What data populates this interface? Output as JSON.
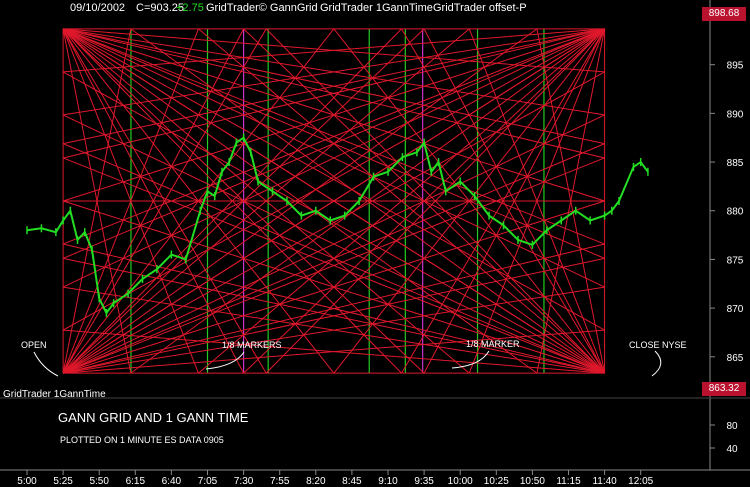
{
  "header": {
    "date": "09/10/2002",
    "close": "C=903.25",
    "change": "+2.75",
    "study1": "GridTrader© GannGrid",
    "study2": "GridTrader 1GannTime",
    "study3": "GridTrader offset-P"
  },
  "grid_high_tag": "898.68",
  "grid_low_tag": "863.32",
  "annotations": {
    "open": "OPEN",
    "marker_left": "1/8 MARKERS",
    "marker_right": "1/8 MARKER",
    "close_nyse": "CLOSE NYSE",
    "bottom_study": "GridTrader 1GannTime",
    "title": "GANN GRID  AND  1 GANN TIME",
    "subtitle": "PLOTTED ON 1 MINUTE ES DATA 0905"
  },
  "colors": {
    "grid": "#e0182c",
    "price": "#22dd22",
    "time_green": "#22cc22",
    "time_magenta": "#cc33cc",
    "tag": "#b9122e",
    "change": "#22dd22",
    "axis": "#888888"
  },
  "chart_data": {
    "type": "line",
    "title": "GANN GRID  AND  1 GANN TIME",
    "ylim": [
      862,
      900
    ],
    "x_tick_labels": [
      "5:00",
      "5:25",
      "5:50",
      "6:15",
      "6:40",
      "7:05",
      "7:30",
      "7:55",
      "8:20",
      "8:45",
      "9:10",
      "9:35",
      "10:00",
      "10:25",
      "10:50",
      "11:15",
      "11:40",
      "12:05"
    ],
    "y_tick_labels": [
      895,
      890,
      885,
      880,
      875,
      870,
      865
    ],
    "lower_panel_ticks": [
      80,
      40
    ],
    "gann_grid": {
      "high": 898.68,
      "low": 863.32,
      "start": "5:25",
      "end": "11:40"
    },
    "time_markers": [
      {
        "time": "6:12",
        "color": "green"
      },
      {
        "time": "7:05",
        "color": "green"
      },
      {
        "time": "7:30",
        "color": "magenta"
      },
      {
        "time": "7:47",
        "color": "green"
      },
      {
        "time": "8:57",
        "color": "green"
      },
      {
        "time": "9:22",
        "color": "green"
      },
      {
        "time": "9:34",
        "color": "magenta"
      },
      {
        "time": "10:12",
        "color": "green"
      },
      {
        "time": "10:58",
        "color": "green"
      }
    ],
    "series": [
      {
        "x": [
          "5:00",
          "5:10",
          "5:20",
          "5:25",
          "5:30",
          "5:35",
          "5:40",
          "5:45",
          "5:50",
          "5:55",
          "6:00",
          "6:10",
          "6:20",
          "6:30",
          "6:40",
          "6:50",
          "7:00",
          "7:05",
          "7:10",
          "7:15",
          "7:20",
          "7:25",
          "7:30",
          "7:35",
          "7:40",
          "7:50",
          "8:00",
          "8:10",
          "8:20",
          "8:30",
          "8:40",
          "8:50",
          "9:00",
          "9:10",
          "9:20",
          "9:30",
          "9:35",
          "9:40",
          "9:45",
          "9:50",
          "10:00",
          "10:10",
          "10:20",
          "10:30",
          "10:40",
          "10:50",
          "11:00",
          "11:10",
          "11:20",
          "11:30",
          "11:40",
          "11:45",
          "11:50",
          "12:00",
          "12:05",
          "12:10"
        ],
        "values": [
          878,
          878.2,
          877.8,
          879,
          880,
          877,
          877.8,
          876,
          871,
          869.5,
          870.5,
          871.5,
          873,
          874,
          875.5,
          875,
          880,
          882,
          881.5,
          884,
          885,
          887,
          887.5,
          886,
          883,
          882,
          881,
          879.5,
          880,
          879,
          879.5,
          881,
          883.5,
          884,
          885.5,
          886,
          887,
          884,
          885,
          882,
          883,
          881.5,
          879.5,
          878.5,
          877,
          876.5,
          878,
          879,
          880,
          879,
          879.5,
          880,
          881,
          884.5,
          885,
          884
        ]
      }
    ]
  }
}
